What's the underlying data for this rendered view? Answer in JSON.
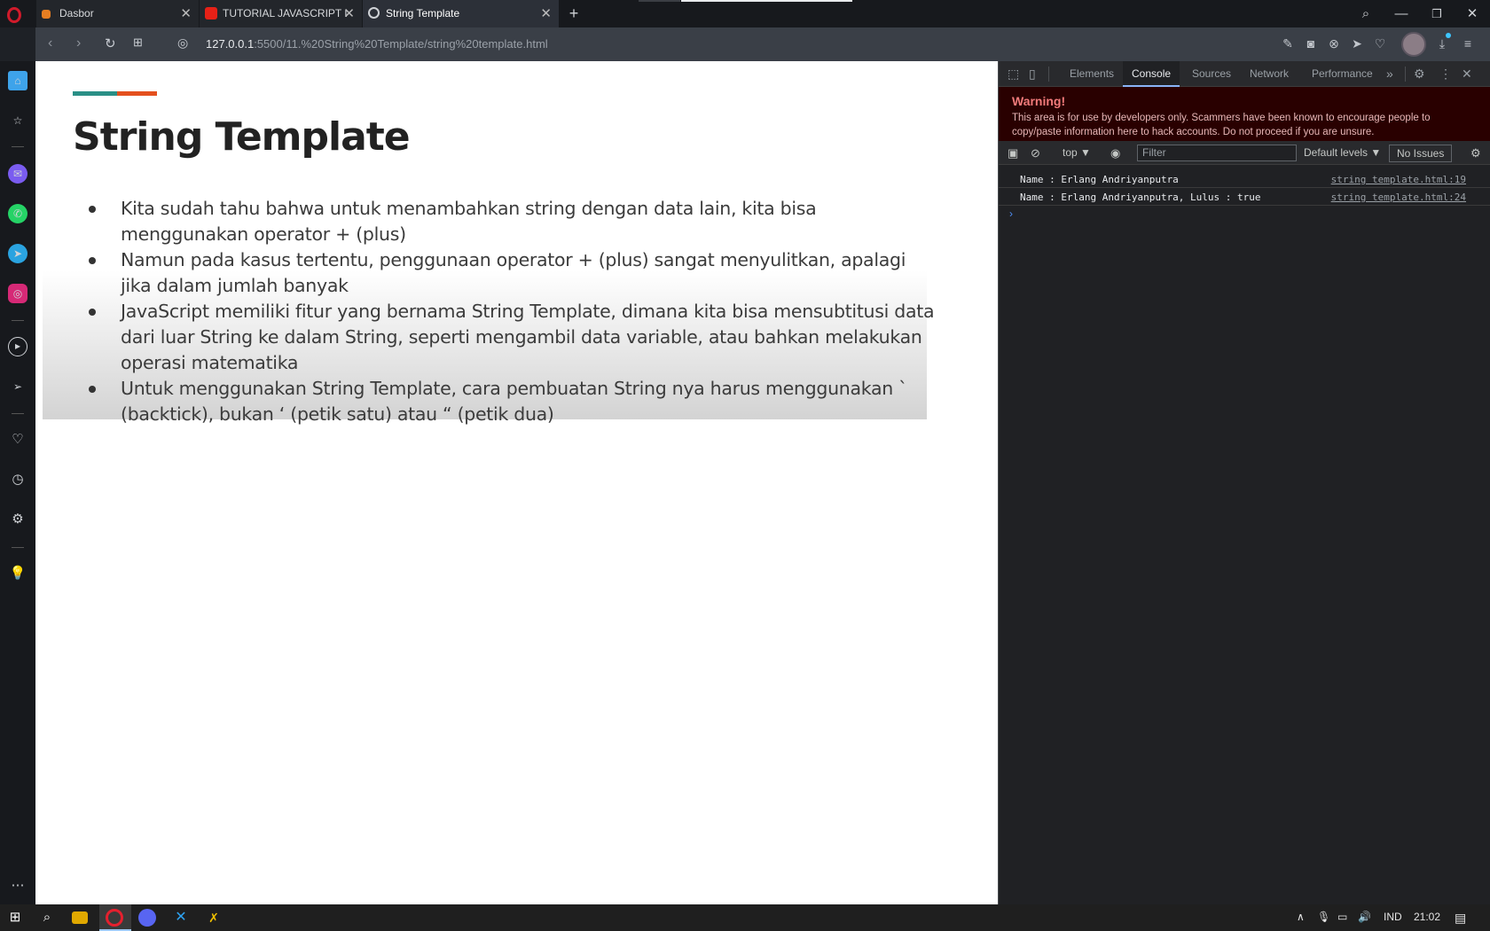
{
  "browser": {
    "tabs": [
      {
        "title": "Dasbor",
        "icon": "dasbor-favicon"
      },
      {
        "title": "TUTORIAL JAVASCRIPT DAS",
        "icon": "youtube-favicon"
      },
      {
        "title": "String Template",
        "icon": "globe-favicon",
        "active": true
      }
    ],
    "new_tab": "+",
    "url_host": "127.0.0.1",
    "url_path": ":5500/11.%20String%20Template/string%20template.html"
  },
  "page": {
    "heading": "String Template",
    "accent_colors": [
      "#2a8f86",
      "#e4501e"
    ],
    "bullets": [
      "Kita sudah tahu bahwa untuk menambahkan string dengan data lain, kita bisa menggunakan operator + (plus)",
      "Namun pada kasus tertentu, penggunaan operator + (plus) sangat menyulitkan, apalagi jika dalam jumlah banyak",
      "JavaScript memiliki fitur yang bernama String Template, dimana kita bisa mensubtitusi data dari luar String ke dalam String, seperti mengambil data variable, atau bahkan melakukan operasi matematika",
      "Untuk menggunakan String Template, cara pembuatan String nya harus menggunakan ` (backtick), bukan ‘ (petik satu) atau “ (petik dua)"
    ]
  },
  "devtools": {
    "tabs": [
      "Elements",
      "Console",
      "Sources",
      "Network",
      "Performance"
    ],
    "active_tab": "Console",
    "more": "»",
    "warning_title": "Warning!",
    "warning_text": "This area is for use by developers only. Scammers have been known to encourage people to copy/paste information here to hack accounts. Do not proceed if you are unsure.",
    "context": "top ▼",
    "filter_placeholder": "Filter",
    "levels": "Default levels ▼",
    "issues": "No Issues",
    "logs": [
      {
        "message": "Name : Erlang Andriyanputra",
        "source": "string template.html:19"
      },
      {
        "message": "Name : Erlang Andriyanputra, Lulus : true",
        "source": "string template.html:24"
      }
    ],
    "prompt": "›"
  },
  "taskbar": {
    "language": "IND",
    "time": "21:02"
  }
}
